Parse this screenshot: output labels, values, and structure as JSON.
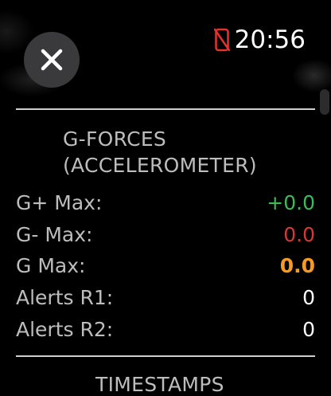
{
  "status_bar": {
    "time": "20:56",
    "disconnected_icon_color": "#e5322d"
  },
  "gforces": {
    "title_line1": "G-FORCES",
    "title_line2": "(ACCELEROMETER)",
    "rows": [
      {
        "label": "G+ Max:",
        "value": "+0.0",
        "color": "#3dba5a"
      },
      {
        "label": "G- Max:",
        "value": "0.0",
        "color": "#d33a35"
      },
      {
        "label": "G Max:",
        "value": "0.0",
        "color": "#f59a23"
      },
      {
        "label": "Alerts R1:",
        "value": "0",
        "color": "#ffffff"
      },
      {
        "label": "Alerts R2:",
        "value": "0",
        "color": "#ffffff"
      }
    ]
  },
  "timestamps": {
    "title": "TIMESTAMPS"
  }
}
